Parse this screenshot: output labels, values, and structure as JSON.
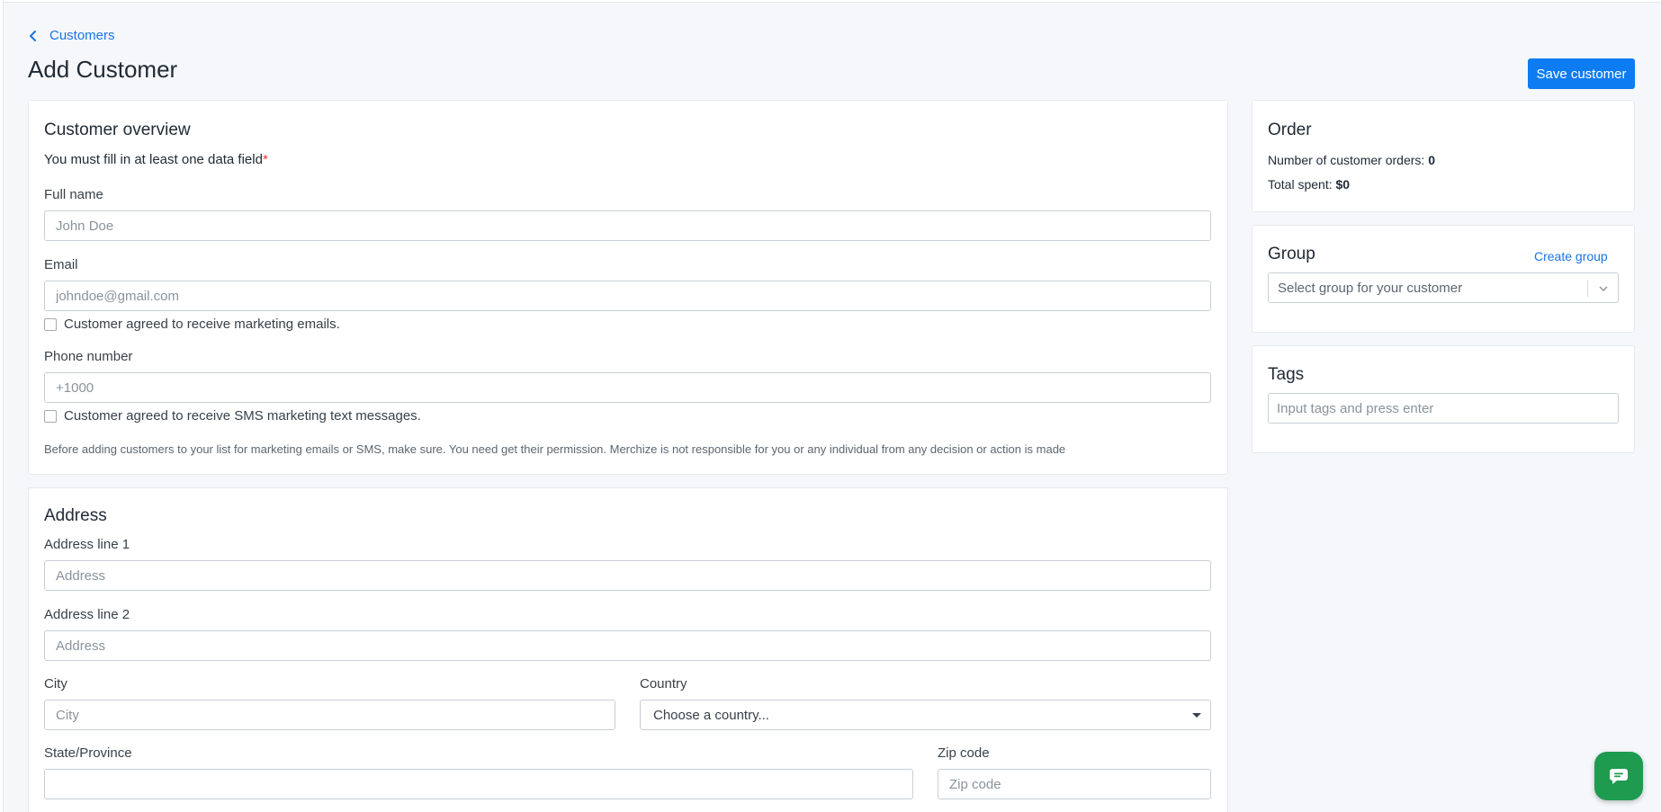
{
  "breadcrumb": {
    "label": "Customers"
  },
  "page": {
    "title": "Add Customer"
  },
  "toolbar": {
    "save_label": "Save customer"
  },
  "overview": {
    "title": "Customer overview",
    "requirement": "You must fill in at least one data field",
    "required_mark": "*",
    "full_name": {
      "label": "Full name",
      "placeholder": "John Doe"
    },
    "email": {
      "label": "Email",
      "placeholder": "johndoe@gmail.com"
    },
    "email_consent": "Customer agreed to receive marketing emails.",
    "phone": {
      "label": "Phone number",
      "placeholder": "+1000"
    },
    "sms_consent": "Customer agreed to receive SMS marketing text messages.",
    "note": "Before adding customers to your list for marketing emails or SMS, make sure. You need get their permission. Merchize is not responsible for you or any individual from any decision or action is made"
  },
  "address": {
    "title": "Address",
    "line1": {
      "label": "Address line 1",
      "placeholder": "Address"
    },
    "line2": {
      "label": "Address line 2",
      "placeholder": "Address"
    },
    "city": {
      "label": "City",
      "placeholder": "City"
    },
    "country": {
      "label": "Country",
      "selected": "Choose a country..."
    },
    "state": {
      "label": "State/Province",
      "placeholder": ""
    },
    "zip": {
      "label": "Zip code",
      "placeholder": "Zip code"
    }
  },
  "order": {
    "title": "Order",
    "orders_label": "Number of customer orders:",
    "orders_value": "0",
    "spent_label": "Total spent:",
    "spent_value": "$0"
  },
  "group": {
    "title": "Group",
    "create_label": "Create group",
    "select_placeholder": "Select group for your customer"
  },
  "tags": {
    "title": "Tags",
    "placeholder": "Input tags and press enter"
  },
  "colors": {
    "accent": "#0d7cf2",
    "link": "#1a73e8",
    "chat": "#1e9b4f",
    "background": "#f5f7fa"
  },
  "icons": {
    "back": "chevron-left-icon",
    "dropdown": "chevron-down-icon",
    "chat": "chat-bubble-icon"
  }
}
